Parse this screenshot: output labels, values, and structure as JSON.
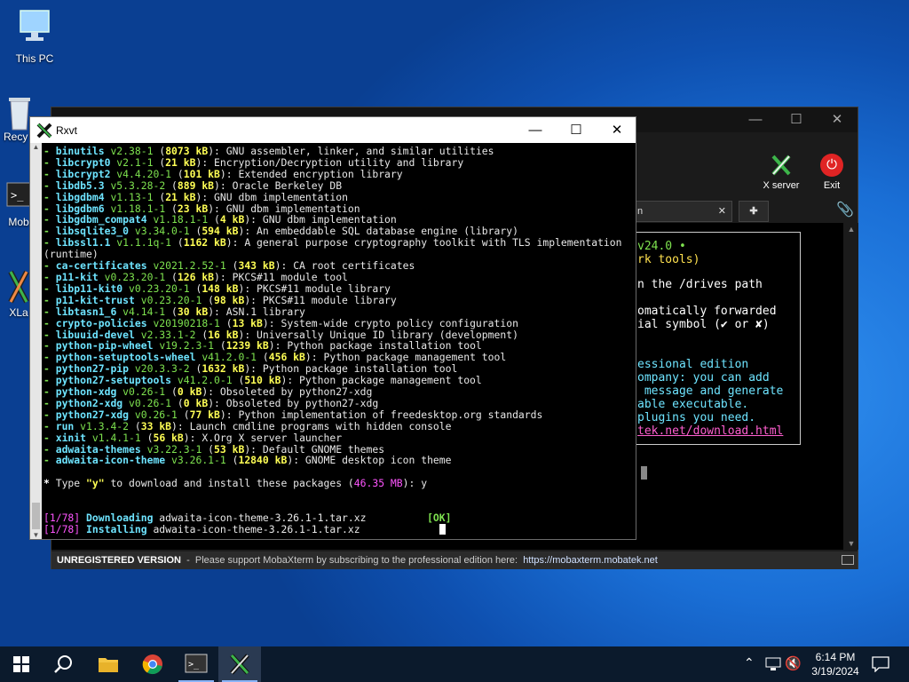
{
  "desktop": {
    "this_pc": "This PC",
    "recycle": "Recy",
    "moba": "Mob",
    "xlaunch": "XLa"
  },
  "moba": {
    "x_server": "X server",
    "exit": "Exit",
    "tab_text": "n",
    "welcome_lines": [
      "v24.0 •",
      "rk tools)",
      "n the /drives path",
      "omatically forwarded",
      "ial symbol (✔ or ✘)",
      "essional edition",
      "ompany: you can add",
      " message and generate",
      "able executable.",
      "plugins you need.",
      "tek.net/download.html"
    ],
    "status": {
      "bold": "UNREGISTERED VERSION",
      "text": "  -  Please support MobaXterm by subscribing to the professional edition here:  ",
      "url": "https://mobaxterm.mobatek.net"
    }
  },
  "rxvt": {
    "title": "Rxvt",
    "packages": [
      [
        "binutils v2.38-1",
        "8073 kB",
        "GNU assembler, linker, and similar utilities"
      ],
      [
        "libcrypt0 v2.1-1",
        "21 kB",
        "Encryption/Decryption utility and library"
      ],
      [
        "libcrypt2 v4.4.20-1",
        "101 kB",
        "Extended encryption library"
      ],
      [
        "libdb5.3 v5.3.28-2",
        "889 kB",
        "Oracle Berkeley DB"
      ],
      [
        "libgdbm4 v1.13-1",
        "21 kB",
        "GNU dbm implementation"
      ],
      [
        "libgdbm6 v1.18.1-1",
        "23 kB",
        "GNU dbm implementation"
      ],
      [
        "libgdbm_compat4 v1.18.1-1",
        "4 kB",
        "GNU dbm implementation"
      ],
      [
        "libsqlite3_0 v3.34.0-1",
        "594 kB",
        "An embeddable SQL database engine (library)"
      ],
      [
        "libssl1.1 v1.1.1q-1",
        "1162 kB",
        "A general purpose cryptography toolkit with TLS implementation"
      ],
      [
        "ca-certificates v2021.2.52-1",
        "343 kB",
        "CA root certificates"
      ],
      [
        "p11-kit v0.23.20-1",
        "126 kB",
        "PKCS#11 module tool"
      ],
      [
        "libp11-kit0 v0.23.20-1",
        "148 kB",
        "PKCS#11 module library"
      ],
      [
        "p11-kit-trust v0.23.20-1",
        "98 kB",
        "PKCS#11 module library"
      ],
      [
        "libtasn1_6 v4.14-1",
        "30 kB",
        "ASN.1 library"
      ],
      [
        "crypto-policies v20190218-1",
        "13 kB",
        "System-wide crypto policy configuration"
      ],
      [
        "libuuid-devel v2.33.1-2",
        "16 kB",
        "Universally Unique ID library (development)"
      ],
      [
        "python-pip-wheel v19.2.3-1",
        "1239 kB",
        "Python package installation tool"
      ],
      [
        "python-setuptools-wheel v41.2.0-1",
        "456 kB",
        "Python package management tool"
      ],
      [
        "python27-pip v20.3.3-2",
        "1632 kB",
        "Python package installation tool"
      ],
      [
        "python27-setuptools v41.2.0-1",
        "510 kB",
        "Python package management tool"
      ],
      [
        "python-xdg v0.26-1",
        "0 kB",
        "Obsoleted by python27-xdg"
      ],
      [
        "python2-xdg v0.26-1",
        "0 kB",
        "Obsoleted by python27-xdg"
      ],
      [
        "python27-xdg v0.26-1",
        "77 kB",
        "Python implementation of freedesktop.org standards"
      ],
      [
        "run v1.3.4-2",
        "33 kB",
        "Launch cmdline programs with hidden console"
      ],
      [
        "xinit v1.4.1-1",
        "56 kB",
        "X.Org X server launcher"
      ],
      [
        "adwaita-themes v3.22.3-1",
        "53 kB",
        "Default GNOME themes"
      ],
      [
        "adwaita-icon-theme v3.26.1-1",
        "12840 kB",
        "GNOME desktop icon theme"
      ]
    ],
    "runtime": "(runtime)",
    "prompt": {
      "pre": " Type ",
      "key": "\"y\"",
      "mid": " to download and install these packages (",
      "size": "46.35 MB",
      "post": "): y"
    },
    "progress1": {
      "count": "[1/78]",
      "verb": "Downloading",
      "file": "adwaita-icon-theme-3.26.1-1.tar.xz",
      "ok": "[OK]"
    },
    "progress2": {
      "count": "[1/78]",
      "verb": "Installing",
      "file": "adwaita-icon-theme-3.26.1-1.tar.xz"
    }
  },
  "taskbar": {
    "time": "6:14 PM",
    "date": "3/19/2024"
  }
}
